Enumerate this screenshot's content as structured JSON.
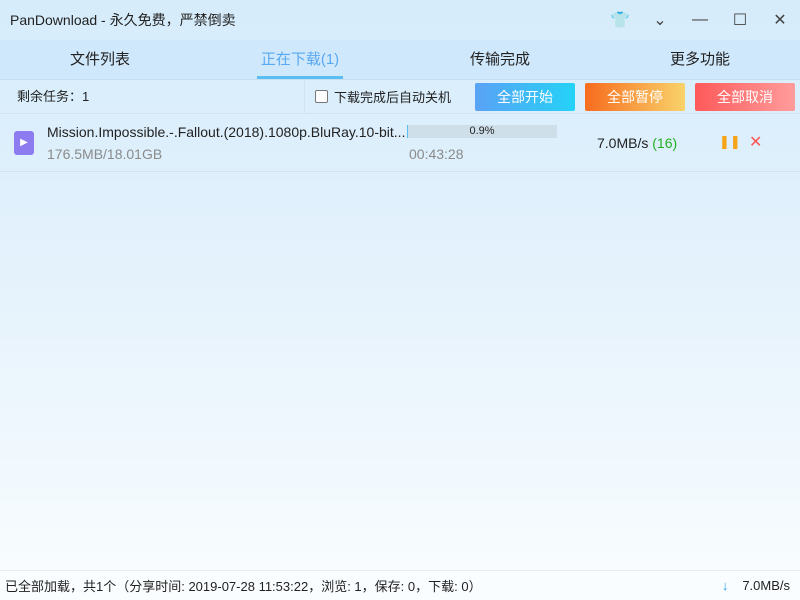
{
  "window": {
    "title": "PanDownload - 永久免费，严禁倒卖",
    "controls": [
      "shirt-icon",
      "chevron-down-icon",
      "minimize-icon",
      "maximize-icon",
      "close-icon"
    ]
  },
  "tabs": [
    {
      "label": "文件列表"
    },
    {
      "label": "正在下载(1)",
      "active": true
    },
    {
      "label": "传输完成"
    },
    {
      "label": "更多功能"
    }
  ],
  "toolbar": {
    "remaining": "剩余任务：1",
    "auto_shutdown_label": "下载完成后自动关机",
    "auto_shutdown_checked": false,
    "start_all": "全部开始",
    "pause_all": "全部暂停",
    "cancel_all": "全部取消"
  },
  "downloads": [
    {
      "name": "Mission.Impossible.-.Fallout.(2018).1080p.BluRay.10-bit...",
      "size": "176.5MB/18.01GB",
      "progress_label": "0.9%",
      "progress": 0.9,
      "eta": "00:43:28",
      "speed": "7.0MB/s",
      "connections": "(16)"
    }
  ],
  "status": {
    "text": "已全部加载，共1个（分享时间: 2019-07-28 11:53:22，浏览: 1，保存: 0，下载: 0）",
    "speed": "7.0MB/s"
  }
}
